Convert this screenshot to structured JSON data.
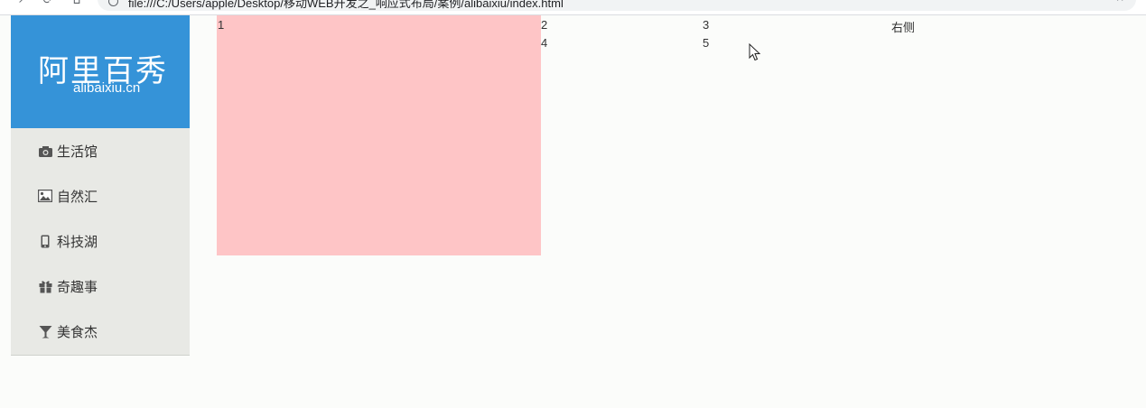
{
  "browser": {
    "url": "file:///C:/Users/apple/Desktop/移动WEB开发之_响应式布局/案例/alibaixiu/index.html",
    "forward_icon": "arrow-forward-icon",
    "reload_icon": "reload-icon",
    "home_icon": "home-icon",
    "bookmark_icon": "star-icon"
  },
  "brand": {
    "name": "阿里百秀",
    "domain": "alibaixiu.cn",
    "color": "#3593d8"
  },
  "menu": [
    {
      "label": "生活馆",
      "icon": "camera-icon"
    },
    {
      "label": "自然汇",
      "icon": "image-icon"
    },
    {
      "label": "科技湖",
      "icon": "phone-icon"
    },
    {
      "label": "奇趣事",
      "icon": "gift-icon"
    },
    {
      "label": "美食杰",
      "icon": "cocktail-icon"
    }
  ],
  "content": {
    "cells": [
      "1",
      "2",
      "3",
      "4",
      "5"
    ],
    "right_label": "右侧",
    "box_color": "#fec5c6"
  }
}
